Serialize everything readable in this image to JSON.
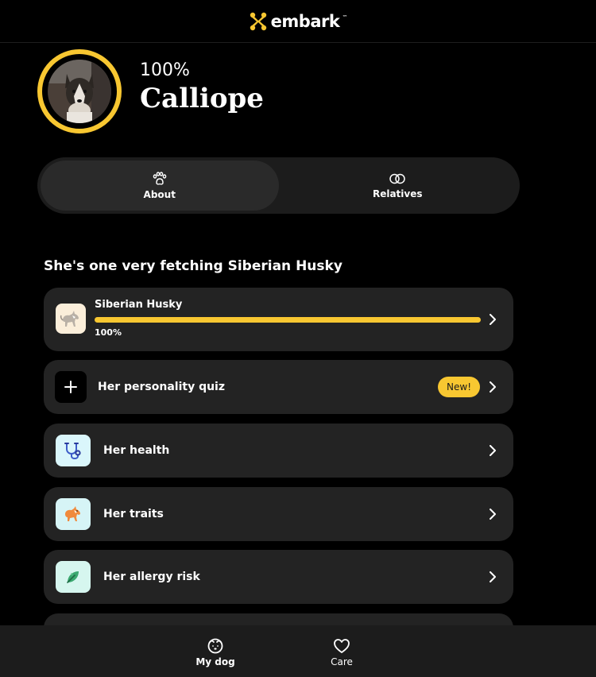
{
  "app": {
    "logo_text": "embark",
    "logo_tm": "™"
  },
  "profile": {
    "percent": "100%",
    "name": "Calliope"
  },
  "tabs": [
    {
      "label": "About",
      "icon": "paw-icon",
      "active": true
    },
    {
      "label": "Relatives",
      "icon": "rings-icon",
      "active": false
    }
  ],
  "main": {
    "heading": "She's one very fetching Siberian Husky",
    "breed": {
      "name": "Siberian Husky",
      "percent_label": "100%",
      "fraction": 1.0
    },
    "cards": [
      {
        "label": "Her personality quiz",
        "icon": "plus-icon",
        "badge": "New!"
      },
      {
        "label": "Her health",
        "icon": "stethoscope-icon"
      },
      {
        "label": "Her traits",
        "icon": "dog-traits-icon"
      },
      {
        "label": "Her allergy risk",
        "icon": "leaf-icon"
      }
    ]
  },
  "bottom_nav": [
    {
      "label": "My dog",
      "icon": "dog-face-icon",
      "active": true
    },
    {
      "label": "Care",
      "icon": "heart-icon",
      "active": false
    }
  ],
  "colors": {
    "accent": "#f8c731",
    "card_bg": "#232323",
    "background": "#000000"
  }
}
